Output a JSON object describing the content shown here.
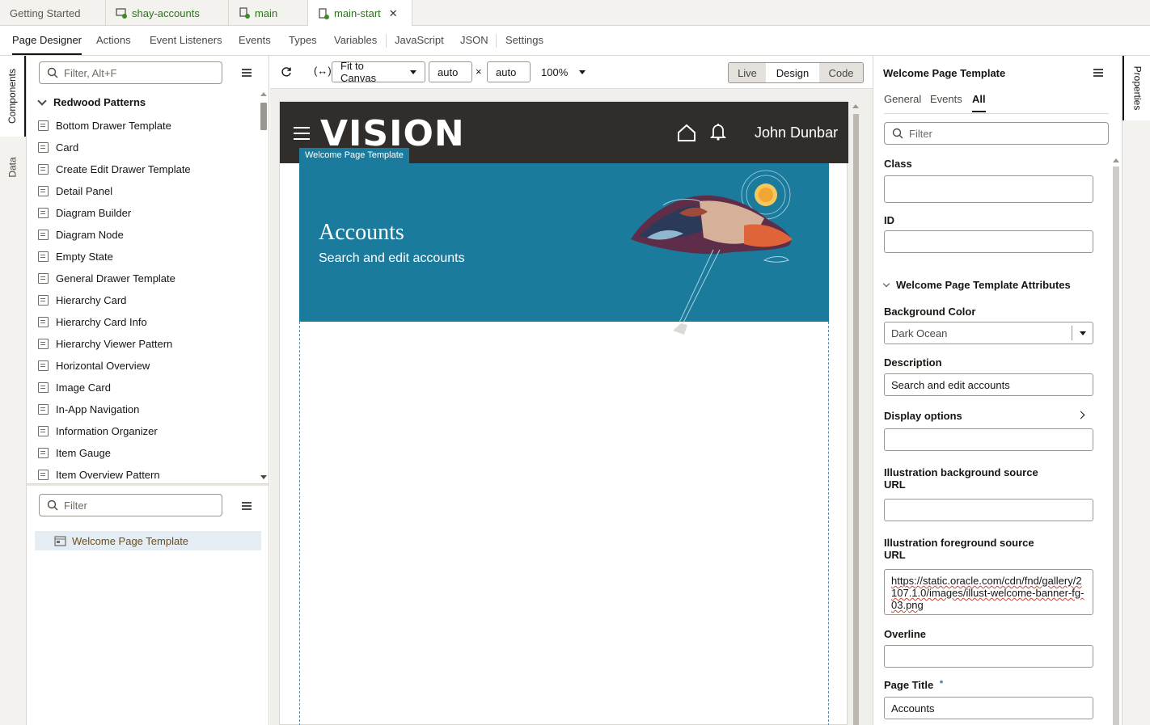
{
  "file_tabs": [
    {
      "label": "Getting Started"
    },
    {
      "label": "shay-accounts"
    },
    {
      "label": "main"
    },
    {
      "label": "main-start"
    }
  ],
  "designer_tabs": [
    "Page Designer",
    "Actions",
    "Event Listeners",
    "Events",
    "Types",
    "Variables",
    "JavaScript",
    "JSON",
    "Settings"
  ],
  "left_rail": {
    "components": "Components",
    "data": "Data"
  },
  "components_panel": {
    "filter_placeholder": "Filter, Alt+F",
    "group": "Redwood Patterns",
    "items": [
      "Bottom Drawer Template",
      "Card",
      "Create Edit Drawer Template",
      "Detail Panel",
      "Diagram Builder",
      "Diagram Node",
      "Empty State",
      "General Drawer Template",
      "Hierarchy Card",
      "Hierarchy Card Info",
      "Hierarchy Viewer Pattern",
      "Horizontal Overview",
      "Image Card",
      "In-App Navigation",
      "Information Organizer",
      "Item Gauge",
      "Item Overview Pattern"
    ]
  },
  "structure_panel": {
    "filter_placeholder": "Filter",
    "item": "Welcome Page Template"
  },
  "canvas_toolbar": {
    "fit": "Fit to Canvas",
    "width": "auto",
    "times": "×",
    "height": "auto",
    "zoom": "100%",
    "modes": [
      "Live",
      "Design",
      "Code"
    ]
  },
  "canvas": {
    "logo": "VISION",
    "user": "John Dunbar",
    "selected_tag": "Welcome Page Template",
    "banner_title": "Accounts",
    "banner_desc": "Search and edit accounts",
    "banner_color": "#1b7b9d"
  },
  "properties": {
    "title": "Welcome Page Template",
    "tabs": [
      "General",
      "Events",
      "All"
    ],
    "filter_placeholder": "Filter",
    "class_label": "Class",
    "class_value": "",
    "id_label": "ID",
    "id_value": "",
    "section": "Welcome Page Template Attributes",
    "bg_label": "Background Color",
    "bg_value": "Dark Ocean",
    "desc_label": "Description",
    "desc_value": "Search and edit accounts",
    "display_label": "Display options",
    "ill_bg_label_1": "Illustration background source",
    "ill_bg_label_2": "URL",
    "ill_bg_value": "",
    "ill_fg_label_1": "Illustration foreground source",
    "ill_fg_label_2": "URL",
    "ill_fg_value": "https://static.oracle.com/cdn/fnd/gallery/2107.1.0/images/illust-welcome-banner-fg-03.png",
    "overline_label": "Overline",
    "overline_value": "",
    "page_title_label": "Page Title",
    "required_mark": "*",
    "page_title_value": "Accounts"
  },
  "right_rail": {
    "properties": "Properties"
  }
}
